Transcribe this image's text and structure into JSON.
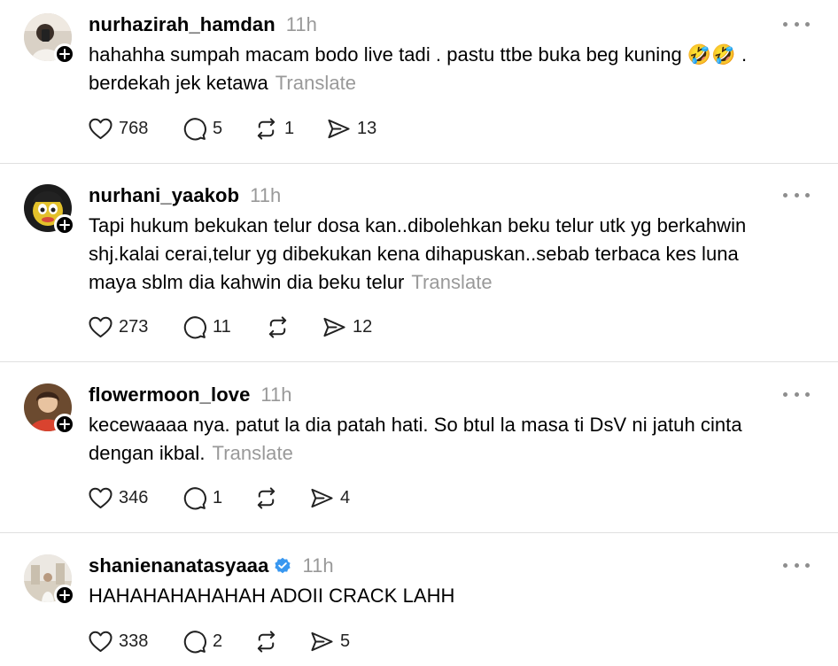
{
  "posts": [
    {
      "username": "nurhazirah_hamdan",
      "time": "11h",
      "text_lines": [
        "hahahha sumpah macam bodo live tadi . pastu ttbe buka beg kuning 🤣🤣 .",
        "berdekah jek ketawa"
      ],
      "translate": "Translate",
      "verified": false,
      "likes": "768",
      "replies": "5",
      "reposts": "1",
      "shares": "13"
    },
    {
      "username": "nurhani_yaakob",
      "time": "11h",
      "text_lines": [
        "Tapi hukum bekukan telur dosa kan..dibolehkan beku telur utk yg berkahwin",
        "shj.kalai cerai,telur yg dibekukan kena dihapuskan..sebab terbaca kes luna",
        "maya sblm dia kahwin dia beku telur"
      ],
      "translate": "Translate",
      "verified": false,
      "likes": "273",
      "replies": "11",
      "reposts": "",
      "shares": "12"
    },
    {
      "username": "flowermoon_love",
      "time": "11h",
      "text_lines": [
        "kecewaaaa nya. patut la dia patah hati. So btul la masa ti DsV ni jatuh cinta",
        "dengan ikbal."
      ],
      "translate": "Translate",
      "verified": false,
      "likes": "346",
      "replies": "1",
      "reposts": "",
      "shares": "4"
    },
    {
      "username": "shanienanatasyaaa",
      "time": "11h",
      "text_lines": [
        "HAHAHAHAHAHAH ADOII CRACK LAHH"
      ],
      "translate": "",
      "verified": true,
      "likes": "338",
      "replies": "2",
      "reposts": "",
      "shares": "5"
    }
  ],
  "icons": {
    "like": "heart-icon",
    "reply": "comment-icon",
    "repost": "repost-icon",
    "share": "share-icon",
    "more": "more-options-icon",
    "follow": "plus-icon",
    "verified": "verified-badge-icon"
  },
  "colors": {
    "verified": "#3897f0",
    "muted_text": "#999999",
    "divider": "#e0e0e0"
  }
}
